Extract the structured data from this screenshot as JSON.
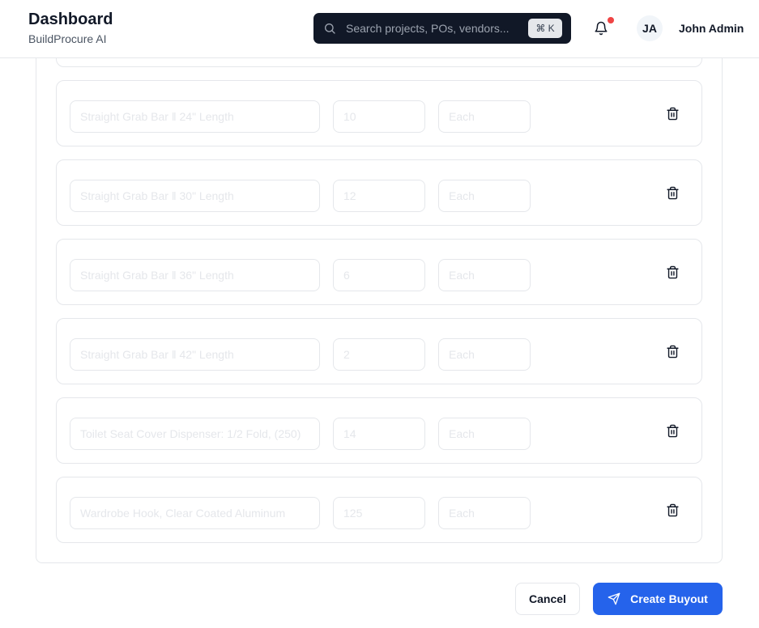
{
  "header": {
    "title": "Dashboard",
    "subtitle": "BuildProcure AI",
    "search_placeholder": "Search projects, POs, vendors...",
    "shortcut": "⌘ K",
    "user_initials": "JA",
    "user_name": "John Admin",
    "notification_dot_color": "#ef4444"
  },
  "line_items": [
    {
      "description": "Straight Grab Bar ‖ 24\" Length",
      "quantity": "10",
      "unit": "Each"
    },
    {
      "description": "Straight Grab Bar ‖ 30\" Length",
      "quantity": "12",
      "unit": "Each"
    },
    {
      "description": "Straight Grab Bar ‖ 36\" Length",
      "quantity": "6",
      "unit": "Each"
    },
    {
      "description": "Straight Grab Bar ‖ 42\" Length",
      "quantity": "2",
      "unit": "Each"
    },
    {
      "description": "Toilet Seat Cover Dispenser: 1/2 Fold, (250)",
      "quantity": "14",
      "unit": "Each"
    },
    {
      "description": "Wardrobe Hook, Clear Coated Aluminum",
      "quantity": "125",
      "unit": "Each"
    }
  ],
  "actions": {
    "cancel_label": "Cancel",
    "create_label": "Create Buyout",
    "primary_color": "#2563eb"
  }
}
